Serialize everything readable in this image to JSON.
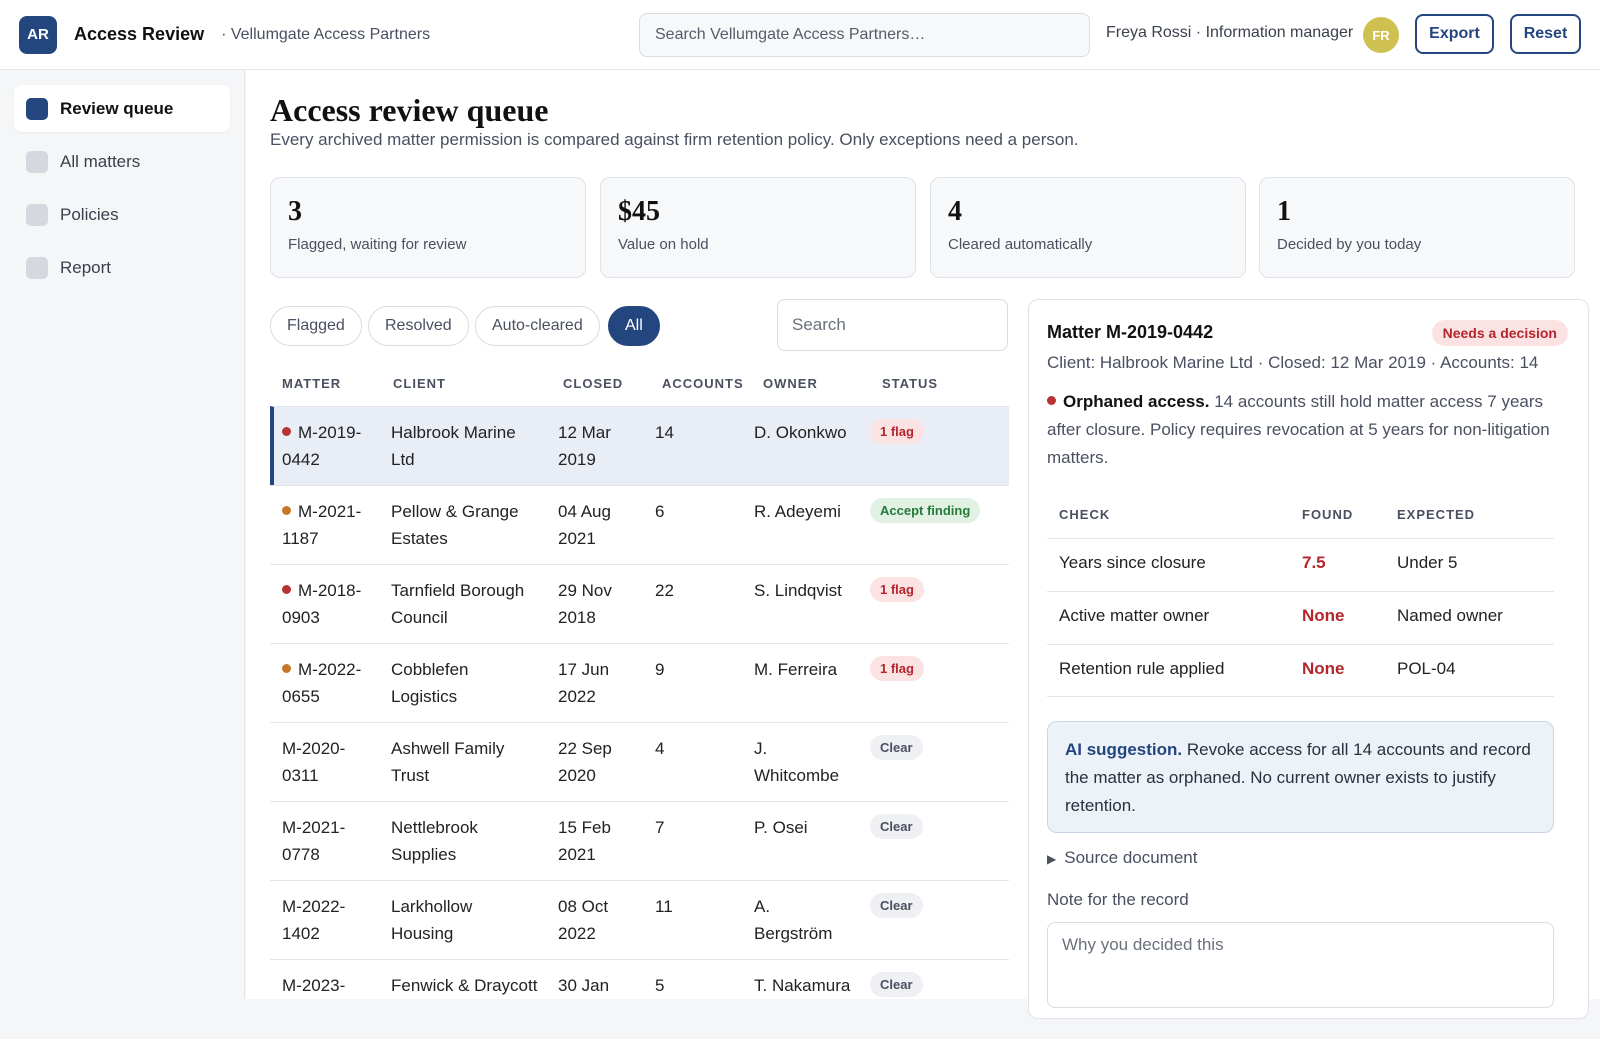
{
  "header": {
    "logo": "AR",
    "app_title": "Access Review",
    "org": "· Vellumgate Access Partners",
    "search_placeholder": "Search Vellumgate Access Partners…",
    "user": "Freya Rossi · Information manager",
    "avatar": "FR",
    "export_label": "Export",
    "reset_label": "Reset"
  },
  "sidebar": {
    "items": [
      {
        "label": "Review queue",
        "active": true
      },
      {
        "label": "All matters"
      },
      {
        "label": "Policies"
      },
      {
        "label": "Report"
      }
    ]
  },
  "main": {
    "title": "Access review queue",
    "subtitle": "Every archived matter permission is compared against firm retention policy. Only exceptions need a person.",
    "stats": [
      {
        "value": "3",
        "label": "Flagged, waiting for review"
      },
      {
        "value": "$45",
        "label": "Value on hold"
      },
      {
        "value": "4",
        "label": "Cleared automatically"
      },
      {
        "value": "1",
        "label": "Decided by you today"
      }
    ],
    "filters": [
      "Flagged",
      "Resolved",
      "Auto-cleared",
      "All"
    ],
    "active_filter": "All",
    "table_search_placeholder": "Search",
    "columns": [
      "MATTER",
      "CLIENT",
      "CLOSED",
      "ACCOUNTS",
      "OWNER",
      "STATUS"
    ],
    "rows": [
      {
        "matter1": "M-2019-",
        "matter2": "0442",
        "client1": "Halbrook Marine",
        "client2": "Ltd",
        "closed1": "12 Mar",
        "closed2": "2019",
        "accounts": "14",
        "owner1": "D. Okonkwo",
        "owner2": "",
        "status": "1 flag",
        "dot": "#b83232"
      },
      {
        "matter1": "M-2021-",
        "matter2": "1187",
        "client1": "Pellow & Grange",
        "client2": "Estates",
        "closed1": "04 Aug",
        "closed2": "2021",
        "accounts": "6",
        "owner1": "R. Adeyemi",
        "owner2": "",
        "status": "Accept finding",
        "dot": "#c8772a"
      },
      {
        "matter1": "M-2018-",
        "matter2": "0903",
        "client1": "Tarnfield Borough",
        "client2": "Council",
        "closed1": "29 Nov",
        "closed2": "2018",
        "accounts": "22",
        "owner1": "S. Lindqvist",
        "owner2": "",
        "status": "1 flag",
        "dot": "#b83232"
      },
      {
        "matter1": "M-2022-",
        "matter2": "0655",
        "client1": "Cobblefen",
        "client2": "Logistics",
        "closed1": "17 Jun",
        "closed2": "2022",
        "accounts": "9",
        "owner1": "M. Ferreira",
        "owner2": "",
        "status": "1 flag",
        "dot": "#c8772a"
      },
      {
        "matter1": "M-2020-",
        "matter2": "0311",
        "client1": "Ashwell Family",
        "client2": "Trust",
        "closed1": "22 Sep",
        "closed2": "2020",
        "accounts": "4",
        "owner1": "J.",
        "owner2": "Whitcombe",
        "status": "Clear",
        "dot": ""
      },
      {
        "matter1": "M-2021-",
        "matter2": "0778",
        "client1": "Nettlebrook",
        "client2": "Supplies",
        "closed1": "15 Feb",
        "closed2": "2021",
        "accounts": "7",
        "owner1": "P. Osei",
        "owner2": "",
        "status": "Clear",
        "dot": ""
      },
      {
        "matter1": "M-2022-",
        "matter2": "1402",
        "client1": "Larkhollow",
        "client2": "Housing",
        "closed1": "08 Oct",
        "closed2": "2022",
        "accounts": "11",
        "owner1": "A.",
        "owner2": "Bergström",
        "status": "Clear",
        "dot": ""
      },
      {
        "matter1": "M-2023-",
        "matter2": "",
        "client1": "Fenwick & Draycott",
        "client2": "",
        "closed1": "30 Jan",
        "closed2": "",
        "accounts": "5",
        "owner1": "T. Nakamura",
        "owner2": "",
        "status": "Clear",
        "dot": ""
      }
    ]
  },
  "detail": {
    "title": "Matter M-2019-0442",
    "badge": "Needs a decision",
    "meta": "Client: Halbrook Marine Ltd · Closed: 12 Mar 2019 · Accounts: 14",
    "finding_title": "Orphaned access.",
    "finding_text": " 14 accounts still hold matter access 7 years after closure. Policy requires revocation at 5 years for non-litigation matters.",
    "check_columns": [
      "CHECK",
      "FOUND",
      "EXPECTED"
    ],
    "checks": [
      {
        "check": "Years since closure",
        "found": "7.5",
        "expected": "Under 5"
      },
      {
        "check": "Active matter owner",
        "found": "None",
        "expected": "Named owner"
      },
      {
        "check": "Retention rule applied",
        "found": "None",
        "expected": "POL-04"
      }
    ],
    "ai_title": "AI suggestion.",
    "ai_text": " Revoke access for all 14 accounts and record the matter as orphaned. No current owner exists to justify retention.",
    "source_label": "Source document",
    "note_label": "Note for the record",
    "note_placeholder": "Why you decided this"
  },
  "colors": {
    "accent": "#24467f",
    "flag": "#b4262c",
    "accept": "#267a3a"
  }
}
